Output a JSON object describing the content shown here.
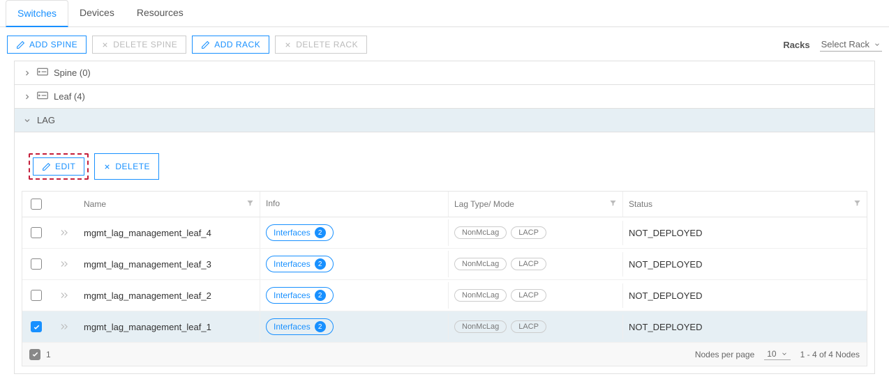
{
  "tabs": {
    "switches": "Switches",
    "devices": "Devices",
    "resources": "Resources"
  },
  "toolbar": {
    "add_spine": "ADD SPINE",
    "delete_spine": "DELETE SPINE",
    "add_rack": "ADD RACK",
    "delete_rack": "DELETE RACK"
  },
  "racks": {
    "label": "Racks",
    "selector": "Select Rack"
  },
  "groups": {
    "spine": "Spine (0)",
    "leaf": "Leaf (4)",
    "lag": "LAG"
  },
  "actions": {
    "edit": "EDIT",
    "delete": "DELETE"
  },
  "columns": {
    "name": "Name",
    "info": "Info",
    "lag": "Lag Type/ Mode",
    "status": "Status"
  },
  "rows": [
    {
      "name": "mgmt_lag_management_leaf_4",
      "info_label": "Interfaces",
      "info_count": "2",
      "lag_type": "NonMcLag",
      "lag_mode": "LACP",
      "status": "NOT_DEPLOYED",
      "selected": false
    },
    {
      "name": "mgmt_lag_management_leaf_3",
      "info_label": "Interfaces",
      "info_count": "2",
      "lag_type": "NonMcLag",
      "lag_mode": "LACP",
      "status": "NOT_DEPLOYED",
      "selected": false
    },
    {
      "name": "mgmt_lag_management_leaf_2",
      "info_label": "Interfaces",
      "info_count": "2",
      "lag_type": "NonMcLag",
      "lag_mode": "LACP",
      "status": "NOT_DEPLOYED",
      "selected": false
    },
    {
      "name": "mgmt_lag_management_leaf_1",
      "info_label": "Interfaces",
      "info_count": "2",
      "lag_type": "NonMcLag",
      "lag_mode": "LACP",
      "status": "NOT_DEPLOYED",
      "selected": true
    }
  ],
  "footer": {
    "selected_count": "1",
    "nodes_per_page_label": "Nodes per page",
    "per_page": "10",
    "range": "1 - 4 of 4 Nodes"
  }
}
